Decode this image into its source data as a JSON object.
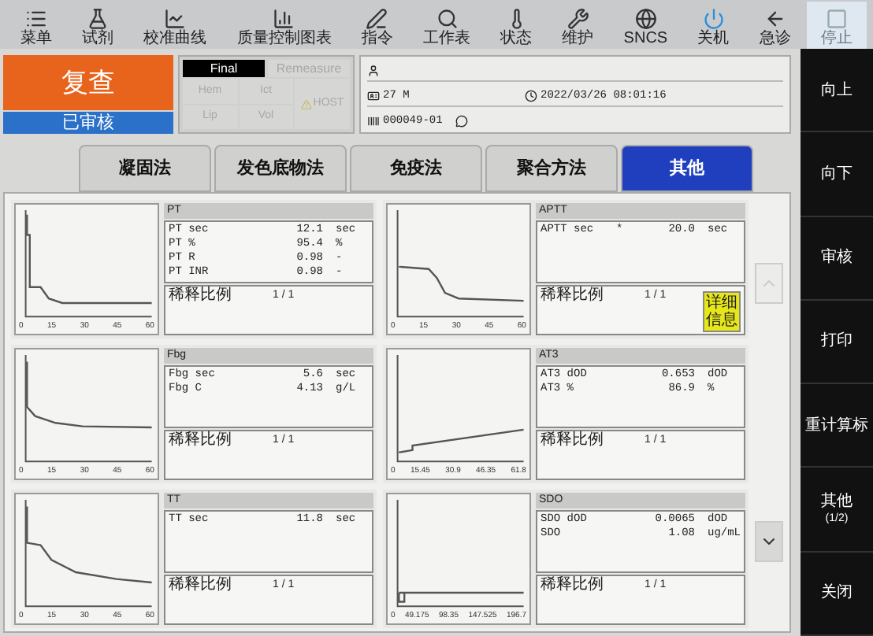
{
  "toolbar": [
    {
      "label": "菜单",
      "disabled": false
    },
    {
      "label": "试剂",
      "disabled": false
    },
    {
      "label": "校准曲线",
      "disabled": false
    },
    {
      "label": "质量控制图表",
      "disabled": false
    },
    {
      "label": "指令",
      "disabled": false
    },
    {
      "label": "工作表",
      "disabled": false
    },
    {
      "label": "状态",
      "disabled": false
    },
    {
      "label": "维护",
      "disabled": false
    },
    {
      "label": "SNCS",
      "disabled": false
    },
    {
      "label": "关机",
      "disabled": false
    },
    {
      "label": "急诊",
      "disabled": false
    },
    {
      "label": "停止",
      "disabled": true
    }
  ],
  "status": {
    "review": "复查",
    "audit": "已审核"
  },
  "flags": {
    "tabs": [
      {
        "label": "Final",
        "selected": true
      },
      {
        "label": "Remeasure",
        "selected": false
      }
    ],
    "items": [
      {
        "label": "Hem",
        "disabled": true
      },
      {
        "label": "Ict",
        "disabled": true
      },
      {
        "label": "Lip",
        "disabled": true
      },
      {
        "label": "Vol",
        "disabled": true
      }
    ],
    "host": {
      "label": "HOST",
      "disabled": true
    }
  },
  "patient": {
    "age_sex": "27 M",
    "datetime": "2022/03/26 08:01:16",
    "sample_id": "000049-01"
  },
  "method_tabs": [
    {
      "label": "凝固法",
      "selected": false
    },
    {
      "label": "发色底物法",
      "selected": false
    },
    {
      "label": "免疫法",
      "selected": false
    },
    {
      "label": "聚合方法",
      "selected": false
    },
    {
      "label": "其他",
      "selected": true
    }
  ],
  "results": [
    {
      "title": "PT",
      "x_ticks": [
        "0",
        "15",
        "30",
        "45",
        "60"
      ],
      "rows": [
        {
          "name": "PT sec",
          "value": "12.1",
          "unit": "sec"
        },
        {
          "name": "PT %",
          "value": "95.4",
          "unit": "%"
        },
        {
          "name": "PT R",
          "value": "0.98",
          "unit": "-"
        },
        {
          "name": "PT INR",
          "value": "0.98",
          "unit": "-"
        }
      ],
      "dilution_label": "稀释比例",
      "dilution": "1 / 1"
    },
    {
      "title": "APTT",
      "x_ticks": [
        "0",
        "15",
        "30",
        "45",
        "60"
      ],
      "rows": [
        {
          "name": "APTT sec",
          "flag": "*",
          "value": "20.0",
          "unit": "sec"
        }
      ],
      "dilution_label": "稀释比例",
      "dilution": "1 / 1",
      "detail_button": "详细信息"
    },
    {
      "title": "Fbg",
      "x_ticks": [
        "0",
        "15",
        "30",
        "45",
        "60"
      ],
      "rows": [
        {
          "name": "Fbg sec",
          "value": "5.6",
          "unit": "sec"
        },
        {
          "name": "Fbg C",
          "value": "4.13",
          "unit": "g/L"
        }
      ],
      "dilution_label": "稀释比例",
      "dilution": "1 / 1"
    },
    {
      "title": "AT3",
      "x_ticks": [
        "0",
        "15.45",
        "30.9",
        "46.35",
        "61.8"
      ],
      "rows": [
        {
          "name": "AT3 dOD",
          "value": "0.653",
          "unit": "dOD"
        },
        {
          "name": "AT3 %",
          "value": "86.9",
          "unit": "%"
        }
      ],
      "dilution_label": "稀释比例",
      "dilution": "1 / 1"
    },
    {
      "title": "TT",
      "x_ticks": [
        "0",
        "15",
        "30",
        "45",
        "60"
      ],
      "rows": [
        {
          "name": "TT sec",
          "value": "11.8",
          "unit": "sec"
        }
      ],
      "dilution_label": "稀释比例",
      "dilution": "1 / 1"
    },
    {
      "title": "SDO",
      "x_ticks": [
        "0",
        "49.175",
        "98.35",
        "147.525",
        "196.7"
      ],
      "rows": [
        {
          "name": "SDO dOD",
          "value": "0.0065",
          "unit": "dOD"
        },
        {
          "name": "SDO",
          "value": "1.08",
          "unit": "ug/mL"
        }
      ],
      "dilution_label": "稀释比例",
      "dilution": "1 / 1"
    }
  ],
  "scroll": {
    "up_disabled": true,
    "down_disabled": false
  },
  "sidebar": [
    {
      "label": "向上"
    },
    {
      "label": "向下"
    },
    {
      "label": "审核"
    },
    {
      "label": "打印"
    },
    {
      "label": "重计算标"
    },
    {
      "label": "其他",
      "sublabel": "(1/2)"
    },
    {
      "label": "关闭"
    }
  ]
}
